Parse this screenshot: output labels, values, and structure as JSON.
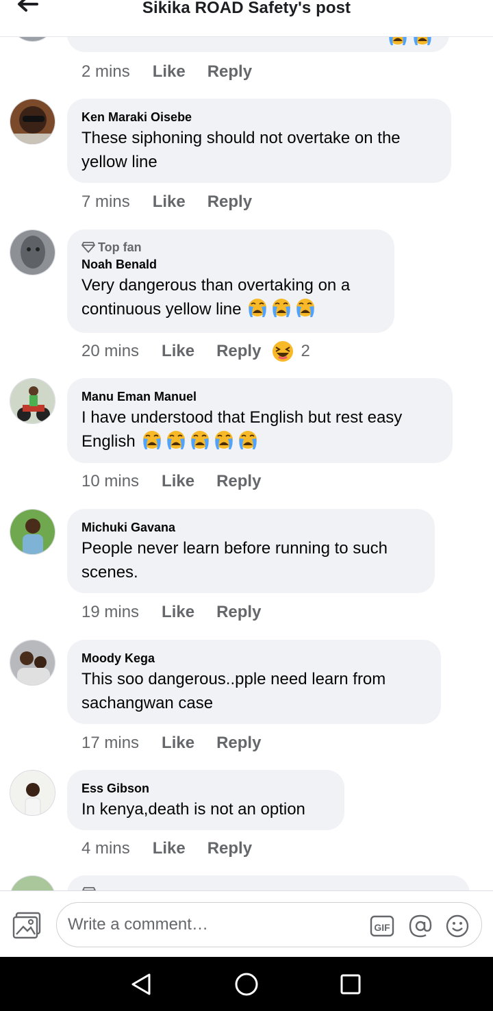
{
  "header": {
    "title": "Sikika ROAD Safety's post"
  },
  "comments": [
    {
      "meta": {
        "time": "2 mins",
        "like": "Like",
        "reply": "Reply"
      }
    },
    {
      "author": "Ken Maraki Oisebe",
      "line1": "These siphoning should not overtake on the",
      "line2": "yellow line",
      "meta": {
        "time": "7 mins",
        "like": "Like",
        "reply": "Reply"
      }
    },
    {
      "badge": "Top fan",
      "author": "Noah Benald",
      "line1": "Very dangerous than overtaking on a",
      "line2": "continuous yellow line",
      "emoji": [
        "crying-face",
        "crying-face",
        "crying-face"
      ],
      "meta": {
        "time": "20 mins",
        "like": "Like",
        "reply": "Reply",
        "reaction": "laughing",
        "reaction_count": "2"
      }
    },
    {
      "author": "Manu Eman Manuel",
      "line1": "I have understood that English but rest easy",
      "line2": "English",
      "emoji": [
        "crying-face",
        "crying-face",
        "crying-face",
        "crying-face",
        "crying-face"
      ],
      "meta": {
        "time": "10 mins",
        "like": "Like",
        "reply": "Reply"
      }
    },
    {
      "author": "Michuki Gavana",
      "line1": "People never learn before running to such",
      "line2": "scenes.",
      "meta": {
        "time": "19 mins",
        "like": "Like",
        "reply": "Reply"
      }
    },
    {
      "author": "Moody Kega",
      "line1": "This soo dangerous..pple  need learn from",
      "line2": "sachangwan case",
      "meta": {
        "time": "17 mins",
        "like": "Like",
        "reply": "Reply"
      }
    },
    {
      "author": "Ess Gibson",
      "line1": "In kenya,death is not an option",
      "meta": {
        "time": "4 mins",
        "like": "Like",
        "reply": "Reply"
      }
    }
  ],
  "composer": {
    "placeholder": "Write a comment…",
    "gif_label": "GIF"
  },
  "icons": {
    "back": "arrow-left-icon",
    "photo": "photo-icon",
    "gif": "gif-icon",
    "mention": "at-sign-icon",
    "emoji": "smiley-icon",
    "nav_back": "triangle-back-icon",
    "nav_home": "circle-home-icon",
    "nav_recent": "square-recent-icon"
  },
  "colors": {
    "bubble": "#f0f2f5",
    "meta": "#65676b",
    "emoji": "#f7b928",
    "navbar": "#000000"
  }
}
